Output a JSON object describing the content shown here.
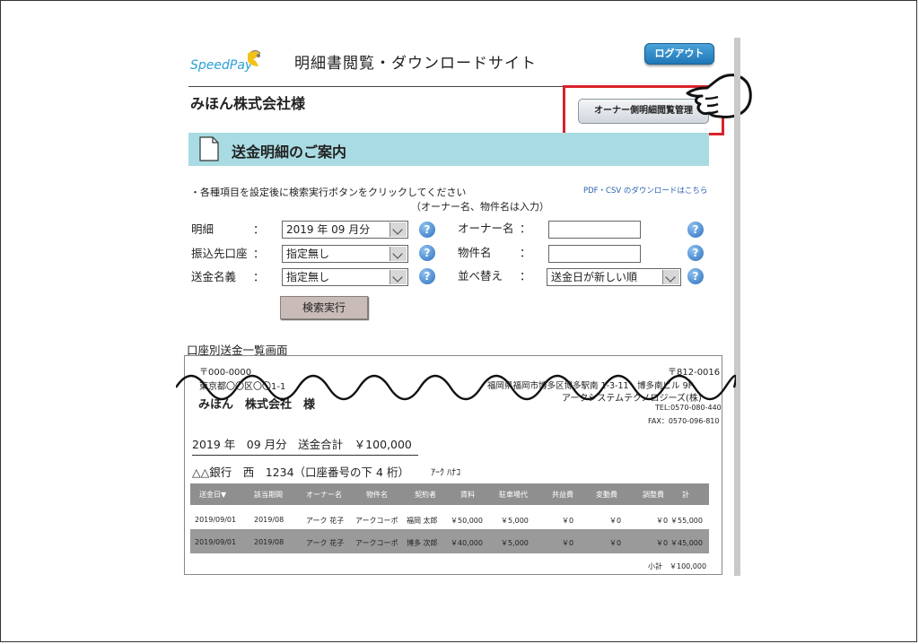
{
  "header": {
    "logo_text": "SpeedPay",
    "site_title": "明細書閲覧・ダウンロードサイト",
    "logout_label": "ログアウト"
  },
  "company_name": "みほん株式会社様",
  "owner_button_label": "オーナー側明細閲覧管理",
  "banner_title": "送金明細のご案内",
  "instructions": {
    "line1": "・各種項目を設定後に検索実行ボタンをクリックしてください",
    "line2": "（オーナー名、物件名は入力）",
    "pdf_link": "PDF・CSV のダウンロードはこちら"
  },
  "form": {
    "meisai_label": "明細",
    "meisai_value": "2019 年 09 月分",
    "furikomi_label": "振込先口座",
    "furikomi_value": "指定無し",
    "sokin_label": "送金名義",
    "sokin_value": "指定無し",
    "owner_label": "オーナー名",
    "owner_value": "",
    "property_label": "物件名",
    "property_value": "",
    "sort_label": "並べ替え",
    "sort_value": "送金日が新しい順",
    "colon": "：",
    "help_glyph": "?",
    "search_button": "検索実行"
  },
  "list_title": "口座別送金一覧画面",
  "statement": {
    "to_zip": "〒000-0000",
    "to_address": "東京都〇〇区〇〇1-1",
    "to_name": "みほん　株式会社　様",
    "from_zip": "〒812-0016",
    "from_address": "福岡県福岡市博多区博多駅南 1-3-11　博多南ビル 9F",
    "from_company": "アークシステムテクノロジーズ(株)",
    "from_tel": "TEL:0570-080-440",
    "from_fax": "FAX：0570-096-810",
    "period_total": "2019 年　09 月分　送金合計　￥100,000",
    "bank_line": "△△銀行　西　1234（口座番号の下 4 桁）",
    "bank_kana": "ｱｰｸ ﾊﾅｺ",
    "columns": [
      "送金日▼",
      "該当期間",
      "オーナー名",
      "物件名",
      "契約者",
      "賃料",
      "駐車場代",
      "共益費",
      "変動費",
      "調整費",
      "計"
    ],
    "rows": [
      [
        "2019/09/01",
        "2019/08",
        "アーク 花子",
        "アークコーポ",
        "福岡 太郎",
        "￥50,000",
        "￥5,000",
        "￥0",
        "￥0",
        "￥0",
        "￥55,000"
      ],
      [
        "2019/09/01",
        "2019/08",
        "アーク 花子",
        "アークコーポ",
        "博多 次郎",
        "￥40,000",
        "￥5,000",
        "￥0",
        "￥0",
        "￥0",
        "￥45,000"
      ]
    ],
    "subtotal_label": "小計",
    "subtotal_value": "￥100,000"
  }
}
